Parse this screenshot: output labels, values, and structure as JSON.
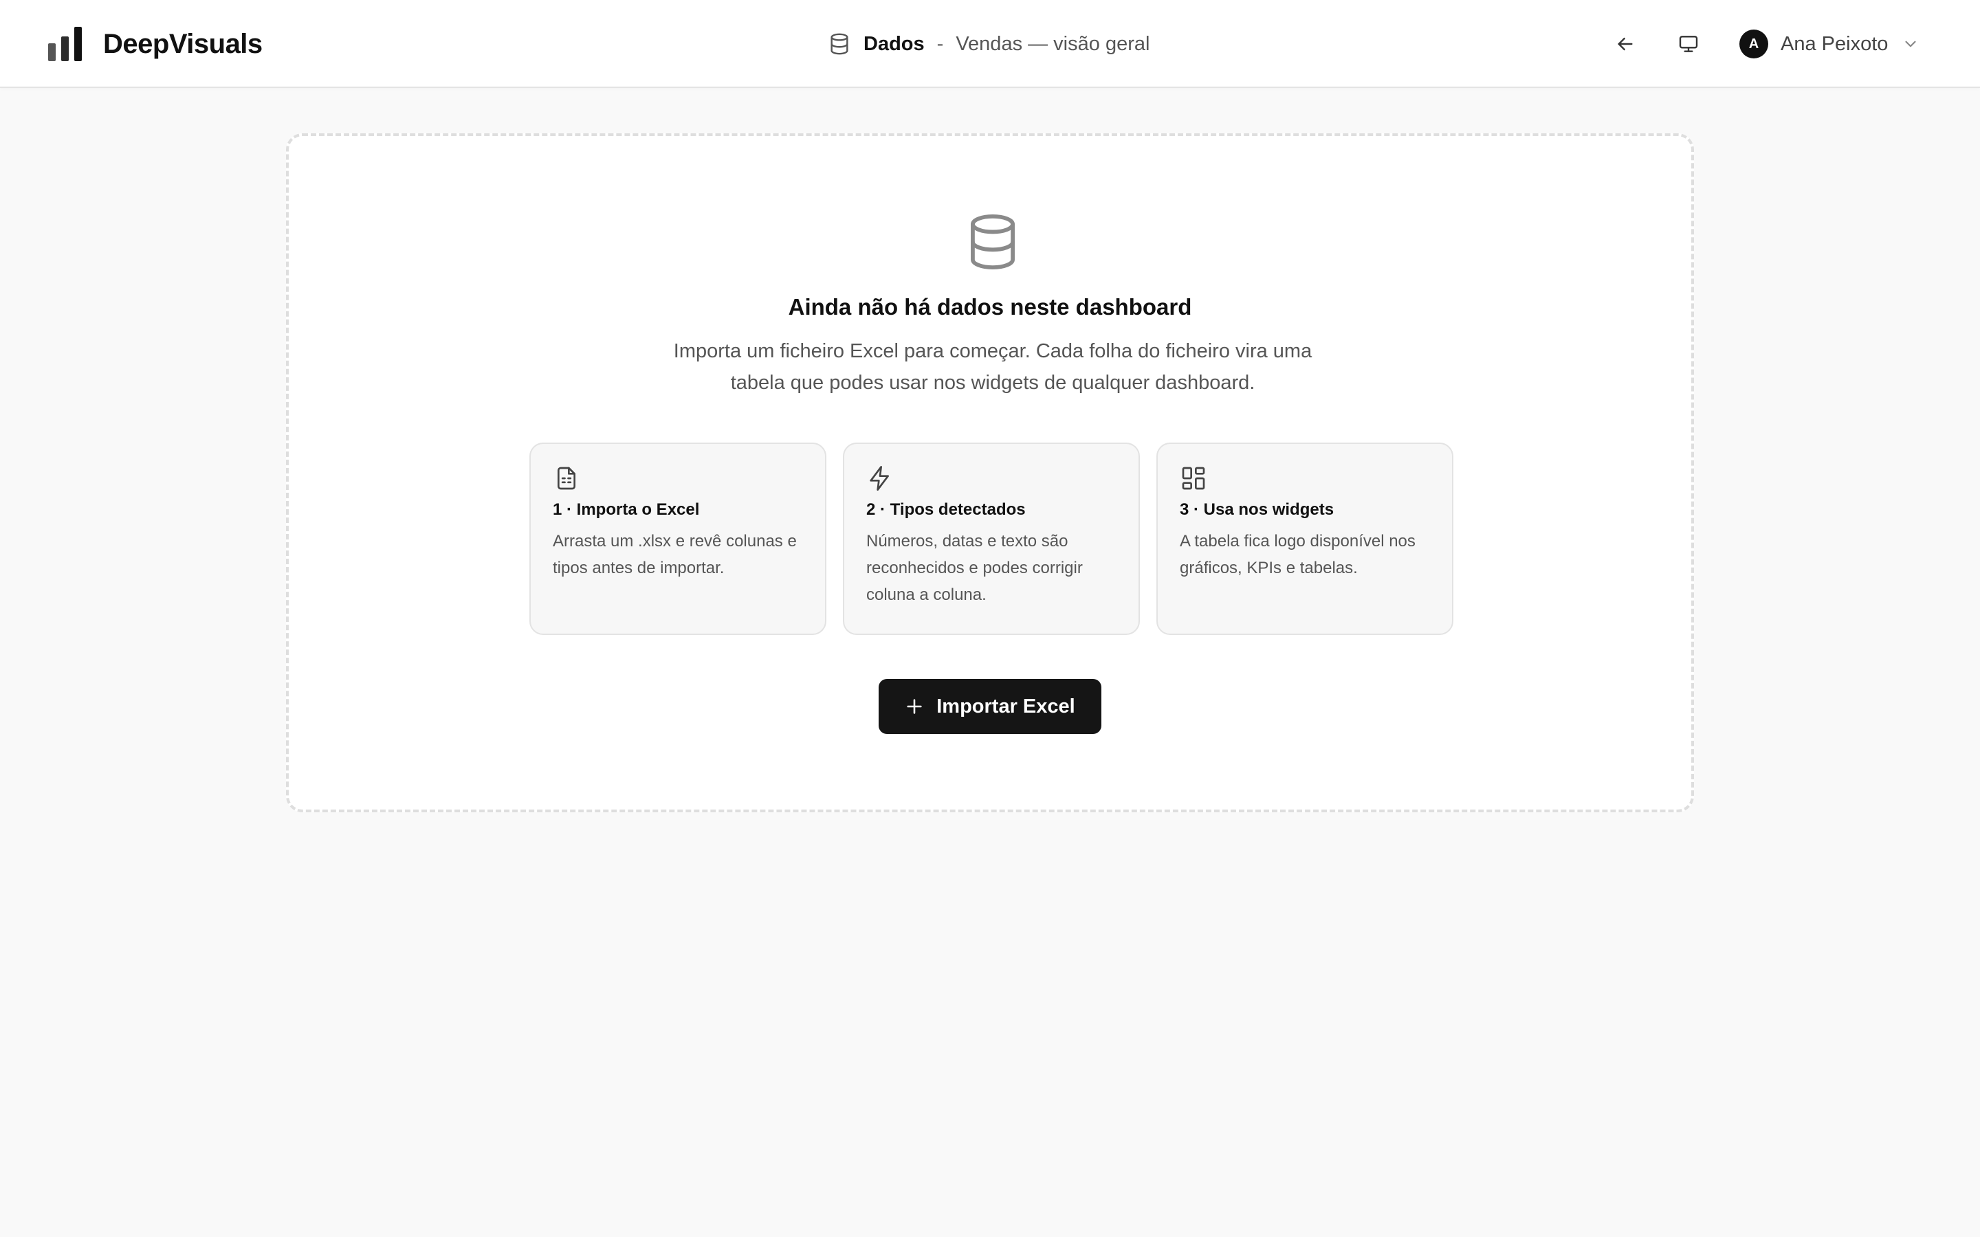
{
  "app": {
    "name": "DeepVisuals",
    "logo_icon": "bar-chart-logo-icon"
  },
  "header": {
    "section_icon": "database-icon",
    "section": "Dados",
    "separator": "-",
    "page": "Vendas — visão geral",
    "back_icon": "arrow-left-icon",
    "present_icon": "monitor-icon"
  },
  "user": {
    "initial": "A",
    "name": "Ana Peixoto",
    "menu_icon": "chevron-down-icon"
  },
  "empty_state": {
    "icon": "database-icon",
    "title": "Ainda não há dados neste dashboard",
    "description": "Importa um ficheiro Excel para começar. Cada folha do ficheiro vira uma tabela que podes usar nos widgets de qualquer dashboard.",
    "steps": [
      {
        "icon": "file-spreadsheet-icon",
        "title": "1 · Importa o Excel",
        "description": "Arrasta um .xlsx e revê colunas e tipos antes de importar."
      },
      {
        "icon": "lightning-bolt-icon",
        "title": "2 · Tipos detectados",
        "description": "Números, datas e texto são reconhecidos e podes corrigir coluna a coluna."
      },
      {
        "icon": "layout-grid-icon",
        "title": "3 · Usa nos widgets",
        "description": "A tabela fica logo disponível nos gráficos, KPIs e tabelas."
      }
    ],
    "import_button": {
      "icon": "plus-icon",
      "label": "Importar Excel"
    }
  },
  "colors": {
    "page_background": "#f9f9f9",
    "surface": "#ffffff",
    "primary_button": "#151515",
    "text_primary": "#111111",
    "text_secondary": "#555555",
    "border": "#e3e3e3"
  }
}
